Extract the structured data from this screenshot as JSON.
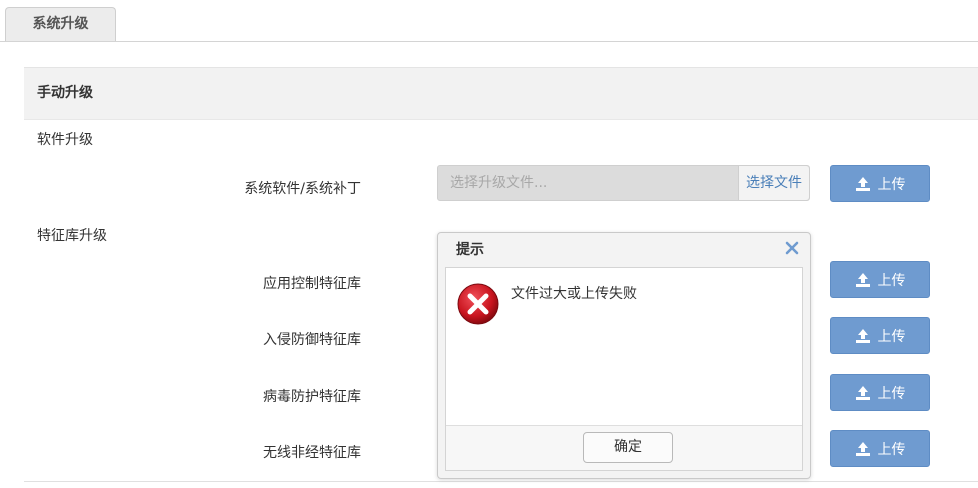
{
  "tabs": [
    {
      "label": "系统升级",
      "active": true
    }
  ],
  "section": {
    "title": "手动升级"
  },
  "software": {
    "heading": "软件升级",
    "row_label": "系统软件/系统补丁",
    "file_placeholder": "选择升级文件...",
    "choose_label": "选择文件"
  },
  "signatures": {
    "heading": "特征库升级",
    "rows": [
      {
        "label": "应用控制特征库"
      },
      {
        "label": "入侵防御特征库"
      },
      {
        "label": "病毒防护特征库"
      },
      {
        "label": "无线非经特征库"
      }
    ]
  },
  "upload_label": "上传",
  "dialog": {
    "title": "提示",
    "message": "文件过大或上传失败",
    "ok_label": "确定",
    "icon": "error-icon"
  },
  "colors": {
    "accent": "#6f9bd0",
    "error": "#c8141e",
    "link": "#4a7fb8"
  }
}
